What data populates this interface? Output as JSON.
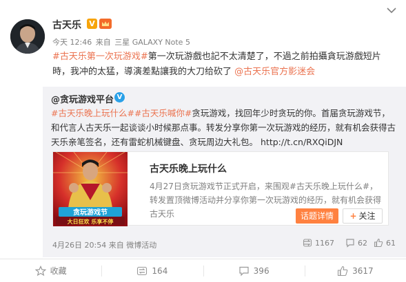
{
  "post": {
    "author": "古天乐",
    "verified_badge": "V",
    "meta": {
      "time": "今天 12:46",
      "from_label": "来自",
      "device": "三星 GALAXY Note 5"
    },
    "text": {
      "hashtag": "#古天乐第一次玩游戏#",
      "body": "第一次玩游戲也記不太清楚了，不過之前拍攝貪玩游戲短片時，我冲的太猛，導演差點讓我的大刀给砍了",
      "mention": "@古天乐官方影迷会"
    }
  },
  "retweet": {
    "author": "@贪玩游戏平台",
    "verified_badge": "V",
    "text": {
      "hashtag1": "#古天乐晚上玩什么#",
      "hashtag2": "#古天乐喊你#",
      "body": "贪玩游戏，找回年少时贪玩的你。首届贪玩游戏节，和代言人古天乐一起谈谈小时候那点事。转发分享你第一次玩游戏的经历，就有机会获得古天乐亲笔签名，还有雷蛇机械键盘、贪玩周边大礼包。",
      "link": "http://t.cn/RXQiDJN"
    },
    "card": {
      "image_text_1": "贪玩游戏节",
      "image_text_2": "大日狂欢 乐享不停",
      "title": "古天乐晚上玩什么",
      "description": "4月27日贪玩游戏节正式开启，来围观#古天乐晚上玩什么#，转发置顶微博活动并分享你第一次玩游戏的经历，就有机会获得古天乐",
      "topic_button": "话题详情",
      "follow_plus": "+",
      "follow_button": "关注"
    },
    "date": "4月26日 20:54",
    "from_label": "来自",
    "source": "微博活动",
    "stats": {
      "forward": "1167",
      "comment": "62",
      "like": "61"
    }
  },
  "actions": {
    "favorite": "收藏",
    "forward": "164",
    "comment": "396",
    "like": "3617"
  },
  "colors": {
    "accent": "#eb7350",
    "orange_button": "#ff8140",
    "verified_blue": "#2aa1e8",
    "verified_gold": "#f7a40a",
    "retweet_bg": "#f2f2f5"
  },
  "icons": [
    "chevron-down-icon",
    "verified-icon",
    "member-icon",
    "forward-icon",
    "comment-icon",
    "like-icon",
    "favorite-icon"
  ]
}
